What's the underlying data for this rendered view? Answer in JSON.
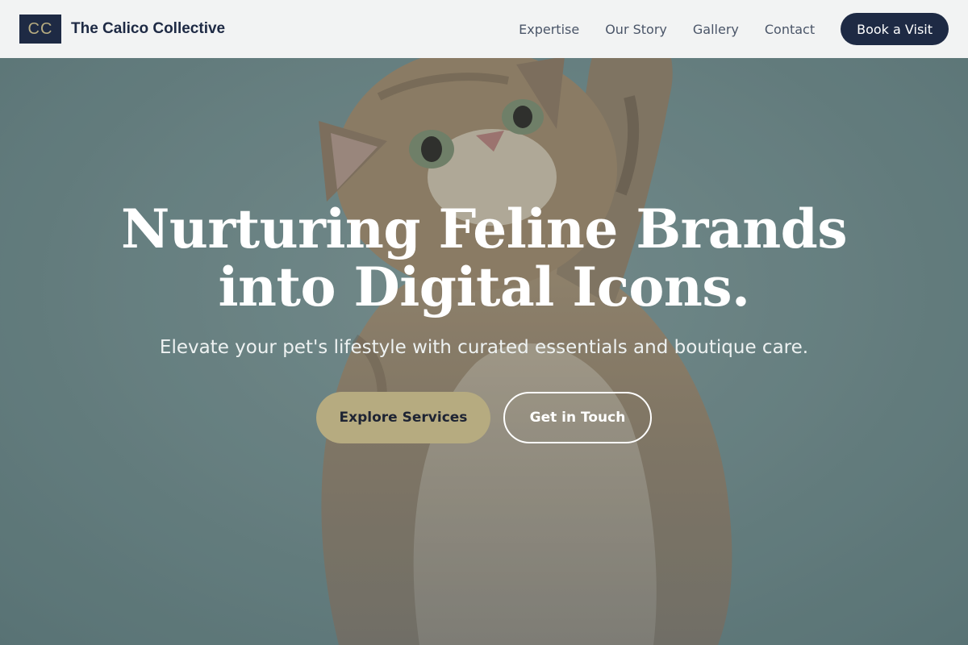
{
  "header": {
    "logo_mark": "CC",
    "brand_name": "The Calico Collective",
    "nav": [
      {
        "label": "Expertise"
      },
      {
        "label": "Our Story"
      },
      {
        "label": "Gallery"
      },
      {
        "label": "Contact"
      }
    ],
    "cta_label": "Book a Visit"
  },
  "hero": {
    "title_line1": "Nurturing Feline Brands",
    "title_line2": "into Digital Icons.",
    "subtitle": "Elevate your pet's lifestyle with curated essentials and boutique care.",
    "primary_button": "Explore Services",
    "secondary_button": "Get in Touch",
    "background_image": "kitten-reaching-up-photo"
  },
  "colors": {
    "navy": "#1e2a44",
    "gold": "#b6ab80",
    "header_bg": "#f2f3f3",
    "hero_teal": "#6f8a8b"
  }
}
